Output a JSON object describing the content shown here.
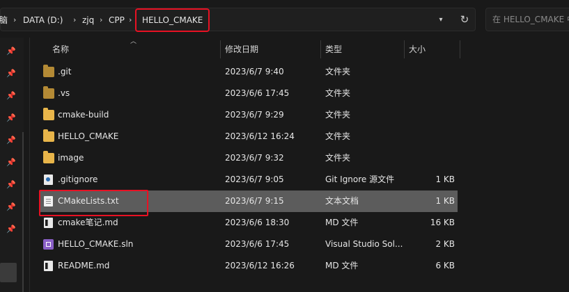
{
  "breadcrumbs": {
    "partial_first": "脑",
    "items": [
      "DATA (D:)",
      "zjq",
      "CPP",
      "HELLO_CMAKE"
    ]
  },
  "search": {
    "placeholder": "在 HELLO_CMAKE 中"
  },
  "icons": {
    "dropdown": "chevron-down-icon",
    "refresh": "refresh-icon",
    "pin": "pin-icon"
  },
  "columns": {
    "name": "名称",
    "date": "修改日期",
    "type": "类型",
    "size": "大小"
  },
  "files": [
    {
      "name": ".git",
      "date": "2023/6/7 9:40",
      "type": "文件夹",
      "size": "",
      "icon": "folder-icon"
    },
    {
      "name": ".vs",
      "date": "2023/6/6 17:45",
      "type": "文件夹",
      "size": "",
      "icon": "folder-icon"
    },
    {
      "name": "cmake-build",
      "date": "2023/6/7 9:29",
      "type": "文件夹",
      "size": "",
      "icon": "folder-icon"
    },
    {
      "name": "HELLO_CMAKE",
      "date": "2023/6/12 16:24",
      "type": "文件夹",
      "size": "",
      "icon": "folder-icon"
    },
    {
      "name": "image",
      "date": "2023/6/7 9:32",
      "type": "文件夹",
      "size": "",
      "icon": "folder-icon"
    },
    {
      "name": ".gitignore",
      "date": "2023/6/7 9:05",
      "type": "Git Ignore 源文件",
      "size": "1 KB",
      "icon": "gitignore-file-icon"
    },
    {
      "name": "CMakeLists.txt",
      "date": "2023/6/7 9:15",
      "type": "文本文档",
      "size": "1 KB",
      "icon": "text-file-icon",
      "selected": true
    },
    {
      "name": "cmake笔记.md",
      "date": "2023/6/6 18:30",
      "type": "MD 文件",
      "size": "16 KB",
      "icon": "markdown-file-icon"
    },
    {
      "name": "HELLO_CMAKE.sln",
      "date": "2023/6/6 17:45",
      "type": "Visual Studio Sol...",
      "size": "2 KB",
      "icon": "visual-studio-solution-icon"
    },
    {
      "name": "README.md",
      "date": "2023/6/12 16:26",
      "type": "MD 文件",
      "size": "6 KB",
      "icon": "markdown-file-icon"
    }
  ],
  "colors": {
    "highlight_box": "#e81123",
    "selected_row": "#5c5c5c",
    "folder": "#e8b54a"
  }
}
